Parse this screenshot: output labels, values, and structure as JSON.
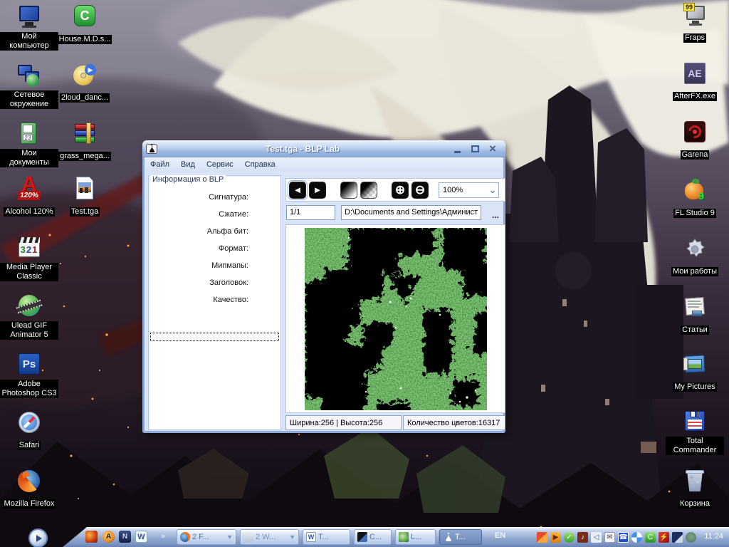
{
  "window": {
    "title": "Test.tga - BLP Lab",
    "menu": [
      "Файл",
      "Вид",
      "Сервис",
      "Справка"
    ],
    "info": {
      "legend": "Информация о BLP",
      "fields": [
        "Сигнатура:",
        "Сжатие:",
        "Альфа бит:",
        "Формат:",
        "Мипмапы:",
        "Заголовок:",
        "Качество:"
      ]
    },
    "toolbar": {
      "zoom_value": "100%",
      "page": "1/1",
      "path": "D:\\Documents and Settings\\Админист",
      "more": "..."
    },
    "status": {
      "dimensions": "Ширина:256 | Высота:256",
      "colors": "Количество цветов:16317"
    }
  },
  "desktop": {
    "left": [
      {
        "label": "Мой компьютер"
      },
      {
        "label": "House.M.D.s..."
      },
      {
        "label": "Сетевое окружение"
      },
      {
        "label": "2loud_danc..."
      },
      {
        "label": "Мои документы"
      },
      {
        "label": "grass_mega..."
      },
      {
        "label": "Alcohol 120%"
      },
      {
        "label": "Test.tga"
      },
      {
        "label": "Media Player Classic"
      },
      {
        "label": "Ulead GIF Animator 5"
      },
      {
        "label": "Adobe Photoshop CS3"
      },
      {
        "label": "Safari"
      },
      {
        "label": "Mozilla Firefox"
      }
    ],
    "right": [
      {
        "label": "Fraps"
      },
      {
        "label": "AfterFX.exe"
      },
      {
        "label": "Garena"
      },
      {
        "label": "FL Studio 9"
      },
      {
        "label": "Мои работы"
      },
      {
        "label": "Статьи"
      },
      {
        "label": "My Pictures"
      },
      {
        "label": "Total Commander"
      },
      {
        "label": "Корзина"
      }
    ]
  },
  "taskbar": {
    "buttons": [
      {
        "label": "2 F..."
      },
      {
        "label": "2 W..."
      },
      {
        "label": "T..."
      },
      {
        "label": "C..."
      },
      {
        "label": "L..."
      },
      {
        "label": "T..."
      }
    ],
    "overflow": "»",
    "language": "EN",
    "clock": "11:24"
  }
}
